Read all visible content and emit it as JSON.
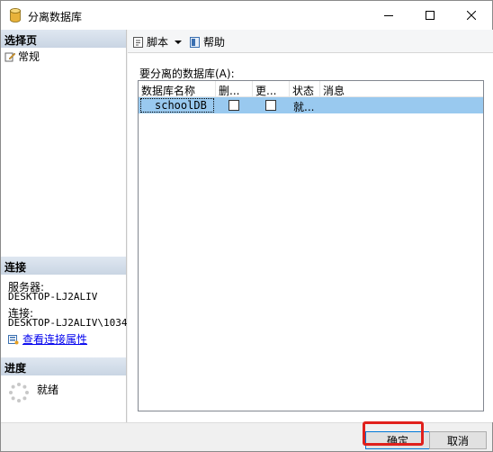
{
  "window": {
    "title": "分离数据库"
  },
  "left": {
    "select_page_header": "选择页",
    "nav_items": [
      {
        "label": "常规"
      }
    ],
    "connection_header": "连接",
    "server_label": "服务器:",
    "server_value": "DESKTOP-LJ2ALIV",
    "connection_label": "连接:",
    "connection_value": "DESKTOP-LJ2ALIV\\1034",
    "view_properties_link": "查看连接属性",
    "progress_header": "进度",
    "progress_status": "就绪"
  },
  "toolbar": {
    "script_label": "脚本",
    "help_label": "帮助"
  },
  "grid": {
    "label": "要分离的数据库(A):",
    "columns": [
      "数据库名称",
      "删...",
      "更...",
      "状态",
      "消息"
    ],
    "rows": [
      {
        "name": "schoolDB",
        "drop": false,
        "update": false,
        "status": "就...",
        "message": ""
      }
    ]
  },
  "footer": {
    "ok_label": "确定",
    "cancel_label": "取消"
  },
  "colors": {
    "selection": "#99c9ef",
    "accent": "#0078d7",
    "highlight": "#e0201c",
    "section_header": "#c9d5e3"
  }
}
